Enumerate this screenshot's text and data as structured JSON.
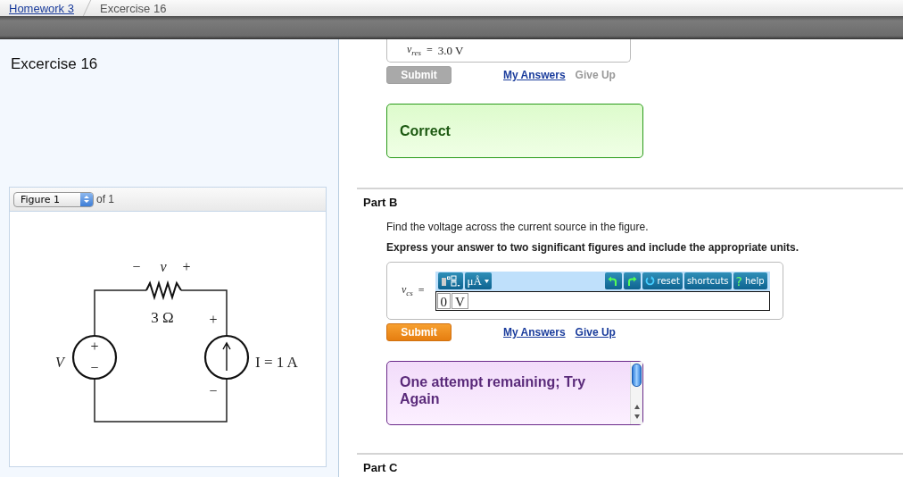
{
  "breadcrumbs": [
    {
      "label": "Homework 3",
      "kind": "link"
    },
    {
      "label": "Excercise 16",
      "kind": "current"
    }
  ],
  "sidebar": {
    "title": "Excercise 16",
    "figure": {
      "selector": "Figure 1",
      "count": "of 1",
      "labels": [
        {
          "kind": "sign",
          "text": "−"
        },
        {
          "kind": "var",
          "text": "v"
        },
        {
          "kind": "sign",
          "text": "+"
        },
        {
          "kind": "value",
          "text": "3 Ω"
        },
        {
          "kind": "sign",
          "text": "+"
        },
        {
          "kind": "sign",
          "text": "−"
        },
        {
          "kind": "var",
          "text": "V"
        },
        {
          "kind": "sign",
          "text": "+"
        },
        {
          "kind": "sign",
          "text": "−"
        },
        {
          "kind": "value",
          "text": "I = 1 A"
        }
      ]
    }
  },
  "part_a": {
    "answer": {
      "variable": "v",
      "subscript": "res",
      "equals": "=",
      "value": "3.0 V"
    },
    "submit": {
      "label": "Submit",
      "disabled": true
    },
    "links": [
      {
        "label": "My Answers",
        "disabled": false
      },
      {
        "label": "Give Up",
        "disabled": true
      }
    ],
    "feedback": {
      "kind": "correct",
      "text": "Correct"
    }
  },
  "part_b": {
    "title": "Part B",
    "prompt": "Find the voltage across the current source in the figure.",
    "instruction": "Express your answer to two significant figures and include the appropriate units.",
    "answer": {
      "variable": "v",
      "subscript": "cs",
      "equals": "=",
      "tools": [
        {
          "kind": "template"
        },
        {
          "kind": "units",
          "label": "μÅ"
        }
      ],
      "actions": [
        {
          "kind": "undo"
        },
        {
          "kind": "redo"
        },
        {
          "kind": "reset",
          "label": "reset"
        },
        {
          "kind": "text",
          "label": "shortcuts"
        },
        {
          "kind": "help",
          "mark": "?",
          "label": "help"
        }
      ],
      "entries": [
        "0",
        "V"
      ]
    },
    "submit": {
      "label": "Submit",
      "disabled": false
    },
    "links": [
      {
        "label": "My Answers",
        "disabled": false
      },
      {
        "label": "Give Up",
        "disabled": false
      }
    ],
    "feedback": {
      "kind": "incorrect",
      "text": "One attempt remaining; Try Again"
    }
  },
  "part_c": {
    "title": "Part C"
  }
}
